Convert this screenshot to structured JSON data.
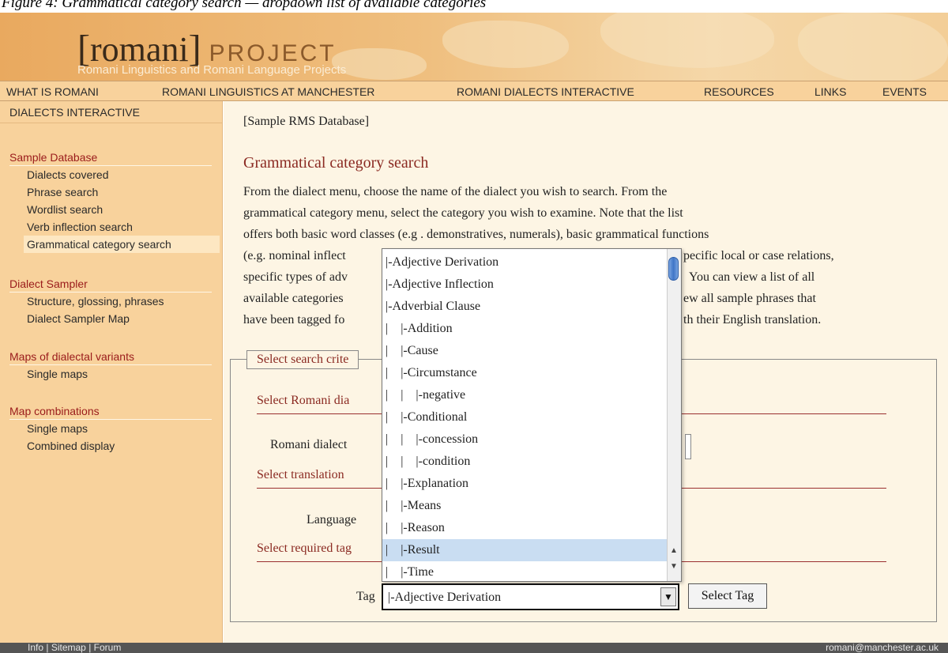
{
  "caption": "Figure 4: Grammatical category search — dropdown list of available categories",
  "header": {
    "brand_name": "romani",
    "brand_open": "[",
    "brand_close": "]",
    "brand_project": "PROJECT",
    "subtitle": "Romani Linguistics and Romani Language Projects"
  },
  "topnav": [
    "WHAT IS ROMANI",
    "ROMANI LINGUISTICS AT MANCHESTER",
    "ROMANI DIALECTS INTERACTIVE",
    "RESOURCES",
    "LINKS",
    "EVENTS"
  ],
  "sidebar": {
    "header": "DIALECTS INTERACTIVE",
    "groups": [
      {
        "title": "Sample Database",
        "items": [
          "Dialects covered",
          "Phrase search",
          "Wordlist search",
          "Verb inflection search",
          "Grammatical category search"
        ]
      },
      {
        "title": "Dialect Sampler",
        "items": [
          "Structure, glossing, phrases",
          "Dialect Sampler Map"
        ]
      },
      {
        "title": "Maps of dialectal variants",
        "items": [
          "Single maps"
        ]
      },
      {
        "title": "Map combinations",
        "items": [
          "Single maps",
          "Combined display"
        ]
      }
    ],
    "active_item": "Grammatical category search"
  },
  "main": {
    "breadcrumb": "[Sample RMS Database]",
    "title": "Grammatical category search",
    "intro_lines": [
      "From the dialect menu, choose the name of the dialect you wish to search. From the",
      "grammatical category menu, select the category you wish to examine. Note that the list",
      "offers both basic word classes (e.g . demonstratives, numerals), basic grammatical functions",
      "(e.g. nominal inflect",
      "specific types of adv",
      "available categories",
      "have been tagged fo"
    ],
    "intro_lines_right": [
      "",
      "",
      "",
      "pecific local or case relations,",
      "You can view a list of all",
      "ew all sample phrases that",
      "th their English translation."
    ],
    "form": {
      "legend": "Select search crite",
      "section_dialect": "Select Romani dia",
      "dialect_label": "Romani dialect",
      "section_translation": "Select translation",
      "language_label": "Language",
      "section_tag": "Select required tag",
      "tag_label": "Tag",
      "tag_selected": "|-Adjective Derivation",
      "tag_button": "Select Tag"
    }
  },
  "dropdown": {
    "items": [
      "|-Adjective Derivation",
      "|-Adjective Inflection",
      "|-Adverbial Clause",
      "|    |-Addition",
      "|    |-Cause",
      "|    |-Circumstance",
      "|    |    |-negative",
      "|    |-Conditional",
      "|    |    |-concession",
      "|    |    |-condition",
      "|    |-Explanation",
      "|    |-Means",
      "|    |-Reason",
      "|    |-Result",
      "|    |-Time"
    ],
    "highlighted": "|    |-Result"
  },
  "footer": {
    "left": [
      "Info",
      "|",
      "Sitemap",
      "|",
      "Forum"
    ],
    "right": "romani@manchester.ac.uk"
  },
  "colors": {
    "banner": "#efbf7f",
    "nav": "#f8d29c",
    "main_bg": "#fdf5e4",
    "accent": "#8b2a22",
    "highlight": "#c9ddf2",
    "footer": "#555555"
  }
}
